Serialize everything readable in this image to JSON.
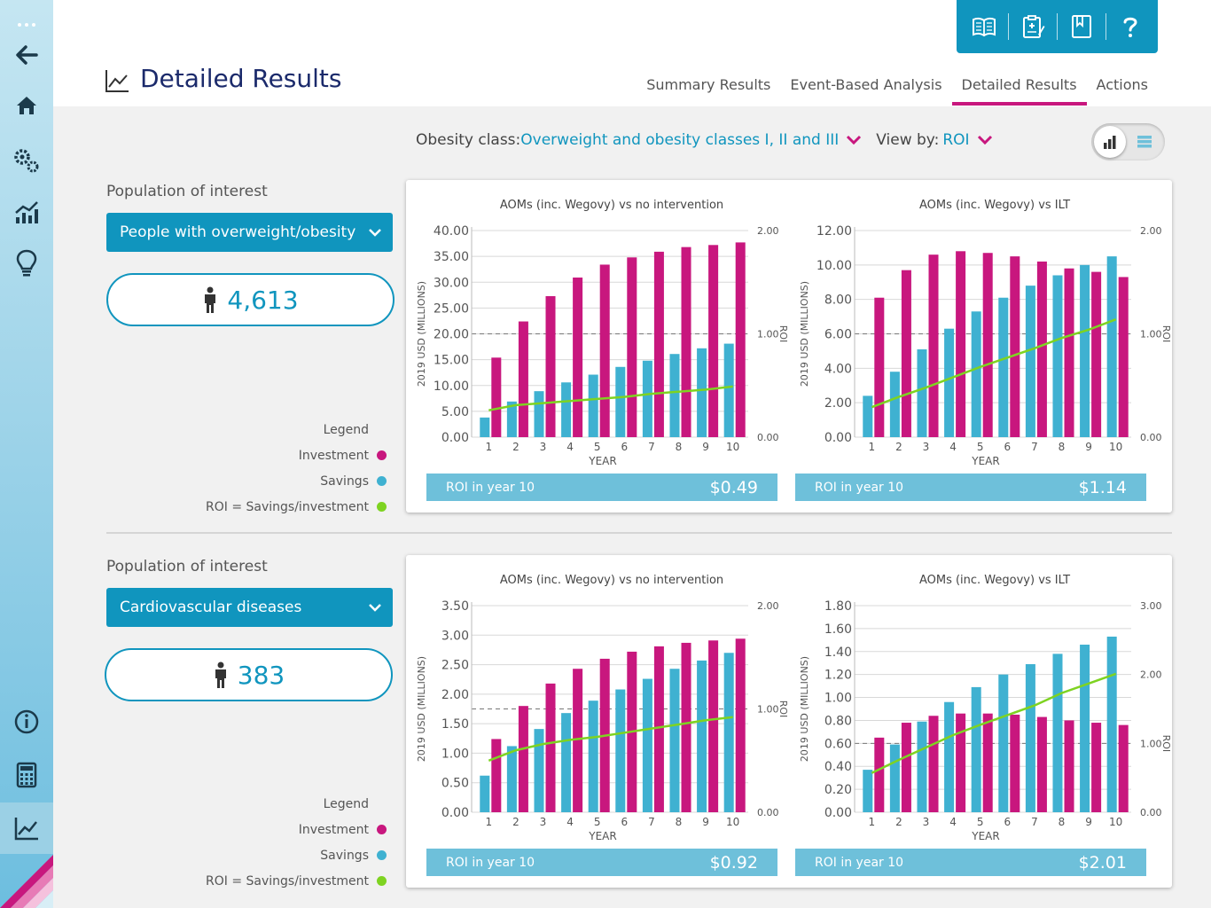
{
  "colors": {
    "accent": "#1095be",
    "investment": "#c8177e",
    "savings": "#3fb1d1",
    "roi": "#7ed321",
    "title": "#1b2a6b"
  },
  "header": {
    "title": "Detailed Results",
    "tabs": [
      {
        "label": "Summary Results",
        "active": false
      },
      {
        "label": "Event-Based Analysis",
        "active": false
      },
      {
        "label": "Detailed Results",
        "active": true
      },
      {
        "label": "Actions",
        "active": false
      }
    ],
    "toolbox_icons": [
      "book-icon",
      "clipboard-icon",
      "bookmark-icon",
      "help-icon"
    ]
  },
  "sidebar": {
    "items": [
      "more-icon",
      "back-arrow-icon",
      "home-icon",
      "settings-icon",
      "chart-up-icon",
      "lightbulb-icon",
      "info-icon",
      "calculator-icon",
      "results-chart-icon"
    ]
  },
  "filter": {
    "obesity_label": "Obesity class:",
    "obesity_value": "Overweight and obesity classes I, II and III",
    "view_label": "View by:",
    "view_value": "ROI"
  },
  "sections": [
    {
      "pop_label": "Population of interest",
      "pop_value": "People with overweight/obesity",
      "count": "4,613",
      "legend_title": "Legend",
      "legend_items": [
        "Investment",
        "Savings",
        "ROI = Savings/investment"
      ]
    },
    {
      "pop_label": "Population of interest",
      "pop_value": "Cardiovascular diseases",
      "count": "383",
      "legend_title": "Legend",
      "legend_items": [
        "Investment",
        "Savings",
        "ROI = Savings/investment"
      ]
    }
  ],
  "chart_data": [
    {
      "type": "bar",
      "title": "AOMs (inc. Wegovy) vs no intervention",
      "xlabel": "YEAR",
      "ylabel": "2019 USD (MILLIONS)",
      "y2label": "ROI",
      "categories": [
        "1",
        "2",
        "3",
        "4",
        "5",
        "6",
        "7",
        "8",
        "9",
        "10"
      ],
      "yticks": [
        "0.00",
        "5.00",
        "10.00",
        "15.00",
        "20.00",
        "25.00",
        "30.00",
        "35.00",
        "40.00"
      ],
      "ylim": [
        0,
        40
      ],
      "y2ticks": [
        "0.00",
        "1.00",
        "2.00"
      ],
      "y2lim": [
        0,
        2
      ],
      "roi_ref": 1,
      "series": [
        {
          "name": "Savings",
          "values": [
            3.8,
            6.9,
            8.9,
            10.6,
            12.1,
            13.6,
            14.8,
            16.1,
            17.2,
            18.1
          ]
        },
        {
          "name": "Investment",
          "values": [
            15.4,
            22.4,
            27.3,
            30.9,
            33.4,
            34.8,
            35.9,
            36.8,
            37.2,
            37.7
          ]
        },
        {
          "name": "ROI",
          "values": [
            0.26,
            0.31,
            0.33,
            0.35,
            0.37,
            0.39,
            0.42,
            0.44,
            0.46,
            0.49
          ]
        }
      ],
      "roi_label": "ROI in year 10",
      "roi_value": "$0.49"
    },
    {
      "type": "bar",
      "title": "AOMs (inc. Wegovy) vs ILT",
      "xlabel": "YEAR",
      "ylabel": "2019 USD (MILLIONS)",
      "y2label": "ROI",
      "categories": [
        "1",
        "2",
        "3",
        "4",
        "5",
        "6",
        "7",
        "8",
        "9",
        "10"
      ],
      "yticks": [
        "0.00",
        "2.00",
        "4.00",
        "6.00",
        "8.00",
        "10.00",
        "12.00"
      ],
      "ylim": [
        0,
        12
      ],
      "y2ticks": [
        "0.00",
        "1.00",
        "2.00"
      ],
      "y2lim": [
        0,
        2
      ],
      "roi_ref": 1,
      "series": [
        {
          "name": "Savings",
          "values": [
            2.4,
            3.8,
            5.1,
            6.3,
            7.3,
            8.1,
            8.8,
            9.4,
            10.0,
            10.5
          ]
        },
        {
          "name": "Investment",
          "values": [
            8.1,
            9.7,
            10.6,
            10.8,
            10.7,
            10.5,
            10.2,
            9.8,
            9.6,
            9.3
          ]
        },
        {
          "name": "ROI",
          "values": [
            0.29,
            0.39,
            0.48,
            0.58,
            0.68,
            0.77,
            0.86,
            0.96,
            1.04,
            1.14
          ]
        }
      ],
      "roi_label": "ROI in year 10",
      "roi_value": "$1.14"
    },
    {
      "type": "bar",
      "title": "AOMs (inc. Wegovy) vs no intervention",
      "xlabel": "YEAR",
      "ylabel": "2019 USD (MILLIONS)",
      "y2label": "ROI",
      "categories": [
        "1",
        "2",
        "3",
        "4",
        "5",
        "6",
        "7",
        "8",
        "9",
        "10"
      ],
      "yticks": [
        "0.00",
        "0.50",
        "1.00",
        "1.50",
        "2.00",
        "2.50",
        "3.00",
        "3.50"
      ],
      "ylim": [
        0,
        3.5
      ],
      "y2ticks": [
        "0.00",
        "1.00",
        "2.00"
      ],
      "y2lim": [
        0,
        2
      ],
      "roi_ref": 1,
      "series": [
        {
          "name": "Savings",
          "values": [
            0.62,
            1.12,
            1.41,
            1.68,
            1.89,
            2.08,
            2.26,
            2.43,
            2.57,
            2.7
          ]
        },
        {
          "name": "Investment",
          "values": [
            1.24,
            1.8,
            2.18,
            2.43,
            2.6,
            2.72,
            2.81,
            2.87,
            2.91,
            2.94
          ]
        },
        {
          "name": "ROI",
          "values": [
            0.5,
            0.6,
            0.66,
            0.7,
            0.73,
            0.77,
            0.81,
            0.85,
            0.89,
            0.92
          ]
        }
      ],
      "roi_label": "ROI in year 10",
      "roi_value": "$0.92"
    },
    {
      "type": "bar",
      "title": "AOMs (inc. Wegovy) vs ILT",
      "xlabel": "YEAR",
      "ylabel": "2019 USD (MILLIONS)",
      "y2label": "ROI",
      "categories": [
        "1",
        "2",
        "3",
        "4",
        "5",
        "6",
        "7",
        "8",
        "9",
        "10"
      ],
      "yticks": [
        "0.00",
        "0.20",
        "0.40",
        "0.60",
        "0.80",
        "1.00",
        "1.20",
        "1.40",
        "1.60",
        "1.80"
      ],
      "ylim": [
        0,
        1.8
      ],
      "y2ticks": [
        "0.00",
        "1.00",
        "2.00",
        "3.00"
      ],
      "y2lim": [
        0,
        3
      ],
      "roi_ref": 1,
      "series": [
        {
          "name": "Savings",
          "values": [
            0.37,
            0.59,
            0.79,
            0.96,
            1.09,
            1.2,
            1.29,
            1.38,
            1.46,
            1.53
          ]
        },
        {
          "name": "Investment",
          "values": [
            0.65,
            0.78,
            0.84,
            0.86,
            0.86,
            0.85,
            0.83,
            0.8,
            0.78,
            0.76
          ]
        },
        {
          "name": "ROI",
          "values": [
            0.57,
            0.76,
            0.94,
            1.12,
            1.27,
            1.41,
            1.55,
            1.73,
            1.87,
            2.01
          ]
        }
      ],
      "roi_label": "ROI in year 10",
      "roi_value": "$2.01"
    }
  ]
}
